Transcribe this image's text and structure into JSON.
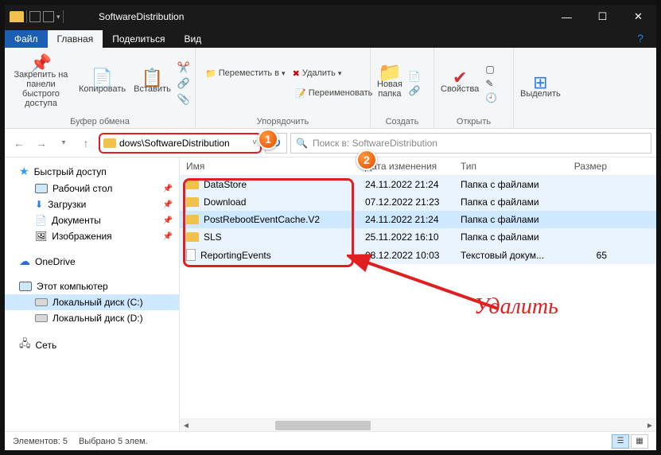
{
  "titlebar": {
    "title": "SoftwareDistribution"
  },
  "winctrls": {
    "min": "—",
    "max": "☐",
    "close": "✕"
  },
  "tabs": {
    "file": "Файл",
    "home": "Главная",
    "share": "Поделиться",
    "view": "Вид"
  },
  "ribbon": {
    "clipboard": {
      "label": "Буфер обмена",
      "pin": "Закрепить на панели\nбыстрого доступа",
      "copy": "Копировать",
      "paste": "Вставить"
    },
    "organize": {
      "label": "Упорядочить",
      "move": "Переместить в",
      "delete": "Удалить",
      "rename": "Переименовать"
    },
    "new": {
      "label": "Создать",
      "newfolder": "Новая\nпапка"
    },
    "open": {
      "label": "Открыть",
      "props": "Свойства"
    },
    "select": {
      "label": "",
      "select": "Выделить"
    }
  },
  "address": {
    "path": "dows\\SoftwareDistribution"
  },
  "search": {
    "placeholder": "Поиск в: SoftwareDistribution"
  },
  "columns": {
    "name": "Имя",
    "date": "Дата изменения",
    "type": "Тип",
    "size": "Размер"
  },
  "sidebar": {
    "quick": "Быстрый доступ",
    "quick_items": [
      {
        "label": "Рабочий стол",
        "pin": true
      },
      {
        "label": "Загрузки",
        "pin": true
      },
      {
        "label": "Документы",
        "pin": true
      },
      {
        "label": "Изображения",
        "pin": true
      }
    ],
    "onedrive": "OneDrive",
    "thispc": "Этот компьютер",
    "thispc_items": [
      {
        "label": "Локальный диск (C:)"
      },
      {
        "label": "Локальный диск (D:)"
      }
    ],
    "network": "Сеть"
  },
  "files": [
    {
      "name": "DataStore",
      "date": "24.11.2022 21:24",
      "type": "Папка с файлами",
      "size": "",
      "icon": "folder"
    },
    {
      "name": "Download",
      "date": "07.12.2022 21:23",
      "type": "Папка с файлами",
      "size": "",
      "icon": "folder"
    },
    {
      "name": "PostRebootEventCache.V2",
      "date": "24.11.2022 21:24",
      "type": "Папка с файлами",
      "size": "",
      "icon": "folder",
      "selected": true
    },
    {
      "name": "SLS",
      "date": "25.11.2022 16:10",
      "type": "Папка с файлами",
      "size": "",
      "icon": "folder"
    },
    {
      "name": "ReportingEvents",
      "date": "08.12.2022 10:03",
      "type": "Текстовый докум...",
      "size": "65",
      "icon": "file"
    }
  ],
  "status": {
    "count": "Элементов: 5",
    "selected": "Выбрано 5 элем."
  },
  "annot": {
    "c1": "1",
    "c2": "2",
    "delete": "Удалить"
  }
}
